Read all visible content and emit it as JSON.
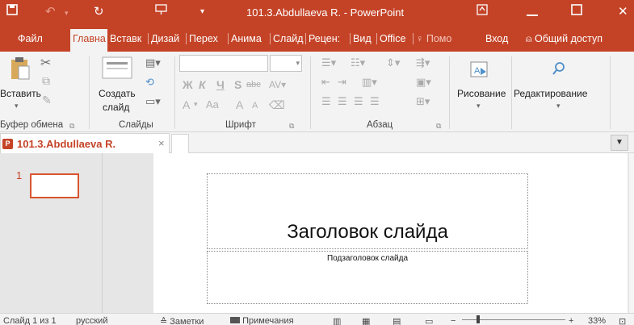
{
  "titlebar": {
    "save_icon": "save-icon",
    "undo_icon": "undo-icon",
    "redo_icon": "redo-icon",
    "present_icon": "present-from-start-icon",
    "customize_icon": "customize-qat-icon",
    "title": "101.3.Abdullaeva R. - PowerPoint",
    "ribbon_options_icon": "ribbon-display-options-icon",
    "minimize_icon": "minimize-icon",
    "maximize_icon": "maximize-icon",
    "close_icon": "close-icon"
  },
  "tabs": [
    "Файл",
    "Главна",
    "Вставк",
    "Дизай",
    "Перех",
    "Анима",
    "Слайд",
    "Рецен:",
    "Вид",
    "Office"
  ],
  "tell_me": "Помо",
  "sign_in": "Вход",
  "share": "Общий доступ",
  "ribbon": {
    "paste": "Вставить",
    "new_slide_line1": "Создать",
    "new_slide_line2": "слайд",
    "clipboard_group": "Буфер обмена",
    "slides_group": "Слайды",
    "font_group": "Шрифт",
    "paragraph_group": "Абзац",
    "drawing": "Рисование",
    "editing": "Редактирование",
    "bold": "Ж",
    "italic": "К",
    "underline": "Ч",
    "shadow": "S",
    "strike": "abc",
    "grow": "A",
    "shrink": "A",
    "case": "Aa"
  },
  "doc": {
    "tab_name": "101.3.Abdullaeva R.",
    "close": "×"
  },
  "slide": {
    "number": "1",
    "title": "Заголовок слайда",
    "subtitle": "Подзаголовок слайда"
  },
  "status": {
    "slide_info": "Слайд 1 из 1",
    "language": "русский",
    "notes": "Заметки",
    "comments": "Примечания",
    "zoom": "33%"
  },
  "colors": {
    "accent": "#c44327",
    "ribbon_bg": "#f3f3f3",
    "workspace_bg": "#e6e6e6"
  }
}
